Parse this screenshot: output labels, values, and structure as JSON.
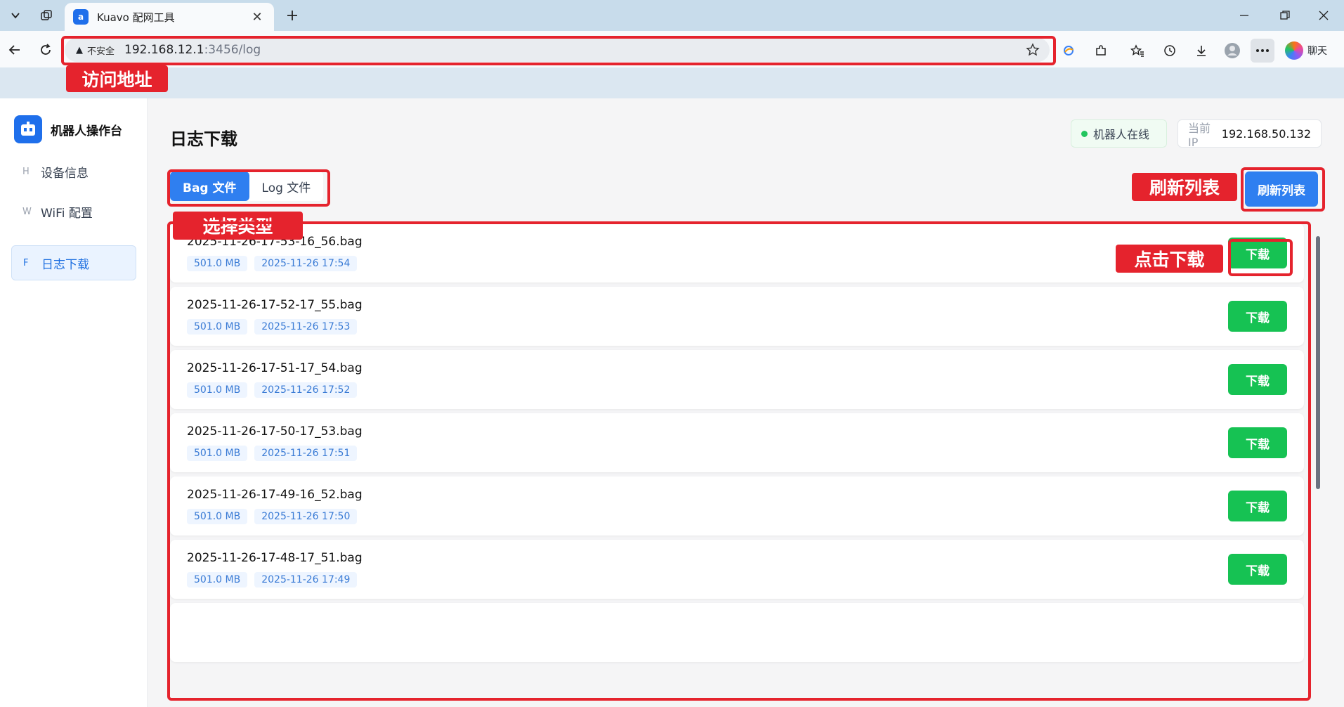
{
  "browser": {
    "tab_title": "Kuavo 配网工具",
    "tab_favicon": "a",
    "address": {
      "insecure_label": "不安全",
      "host": "192.168.12.1",
      "path": ":3456/log"
    },
    "chat_label": "聊天"
  },
  "sidebar": {
    "brand": "机器人操作台",
    "items": [
      {
        "key": "H",
        "label": "设备信息",
        "active": false
      },
      {
        "key": "W",
        "label": "WiFi 配置",
        "active": false
      },
      {
        "key": "F",
        "label": "日志下载",
        "active": true
      }
    ]
  },
  "header": {
    "title": "日志下载",
    "status": "机器人在线",
    "ip_label": "当前 IP",
    "ip_value": "192.168.50.132"
  },
  "tabs": {
    "bag": "Bag 文件",
    "log": "Log 文件"
  },
  "refresh_label": "刷新列表",
  "download_label": "下载",
  "files": [
    {
      "name": "2025-11-26-17-53-16_56.bag",
      "size": "501.0 MB",
      "time": "2025-11-26 17:54"
    },
    {
      "name": "2025-11-26-17-52-17_55.bag",
      "size": "501.0 MB",
      "time": "2025-11-26 17:53"
    },
    {
      "name": "2025-11-26-17-51-17_54.bag",
      "size": "501.0 MB",
      "time": "2025-11-26 17:52"
    },
    {
      "name": "2025-11-26-17-50-17_53.bag",
      "size": "501.0 MB",
      "time": "2025-11-26 17:51"
    },
    {
      "name": "2025-11-26-17-49-16_52.bag",
      "size": "501.0 MB",
      "time": "2025-11-26 17:50"
    },
    {
      "name": "2025-11-26-17-48-17_51.bag",
      "size": "501.0 MB",
      "time": "2025-11-26 17:49"
    }
  ],
  "annotations": {
    "address": "访问地址",
    "type": "选择类型",
    "refresh": "刷新列表",
    "download": "点击下载"
  },
  "colors": {
    "accent": "#2f7ff0",
    "download": "#16c253",
    "annotation": "#e5232d"
  }
}
